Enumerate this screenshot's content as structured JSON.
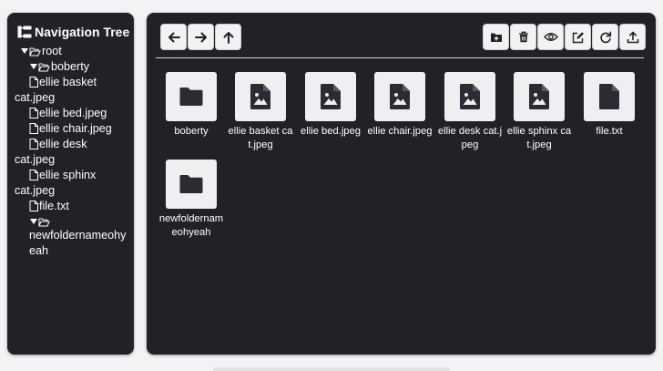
{
  "sidebar": {
    "title": "Navigation Tree",
    "root_label": "root",
    "subfolder1": {
      "name": "boberty",
      "files": [
        {
          "line1": "ellie basket",
          "line2": "cat.jpeg"
        },
        {
          "line1": "ellie bed.jpeg",
          "line2": ""
        },
        {
          "line1": "ellie chair.jpeg",
          "line2": ""
        },
        {
          "line1": "ellie desk",
          "line2": "cat.jpeg"
        },
        {
          "line1": "ellie sphinx",
          "line2": "cat.jpeg"
        },
        {
          "line1": "file.txt",
          "line2": ""
        }
      ]
    },
    "subfolder2": {
      "line1": "",
      "line2": "newfoldernameohy",
      "line3": "eah"
    }
  },
  "toolbar": {
    "back_icon": "arrow-left-icon",
    "forward_icon": "arrow-right-icon",
    "up_icon": "arrow-up-icon",
    "new_folder_icon": "folder-plus-icon",
    "delete_icon": "trash-icon",
    "view_icon": "eye-icon",
    "rename_icon": "edit-icon",
    "refresh_icon": "refresh-icon",
    "upload_icon": "upload-icon"
  },
  "items": [
    {
      "name": "boberty",
      "kind": "folder"
    },
    {
      "name": "ellie basket cat.jpeg",
      "kind": "image"
    },
    {
      "name": "ellie bed.jpeg",
      "kind": "image"
    },
    {
      "name": "ellie chair.jpeg",
      "kind": "image"
    },
    {
      "name": "ellie desk cat.jpeg",
      "kind": "image"
    },
    {
      "name": "ellie sphinx cat.jpeg",
      "kind": "image"
    },
    {
      "name": "file.txt",
      "kind": "file"
    },
    {
      "name": "newfoldernameohyeah",
      "kind": "folder"
    }
  ],
  "colors": {
    "panel": "#212227",
    "tile": "#efeff2",
    "icon": "#2b2c33",
    "background": "#f3f3f5"
  }
}
